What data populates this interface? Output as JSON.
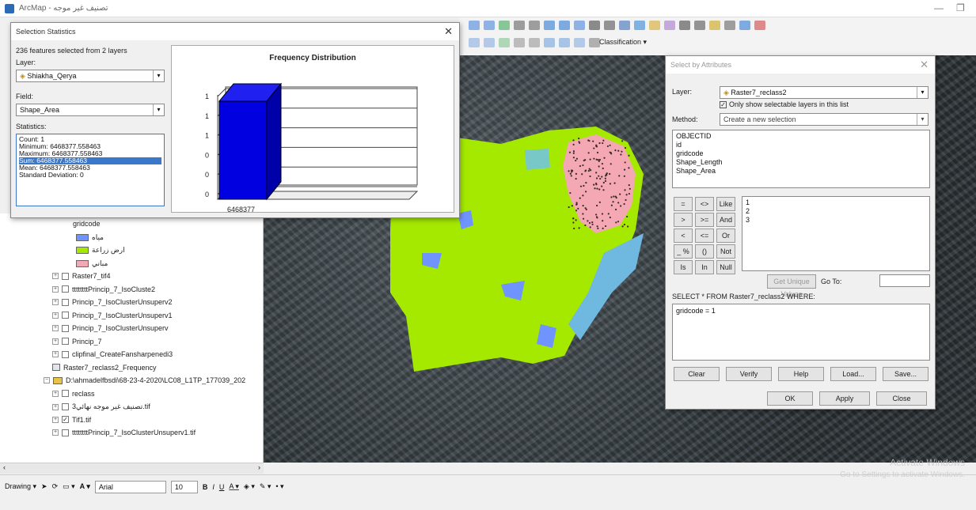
{
  "window": {
    "title": "ArcMap - تصنيف غير موجه"
  },
  "toolbar": {
    "classification_label": "Classification ▾"
  },
  "selection_stats": {
    "title": "Selection Statistics",
    "summary": "236 features selected from 2 layers",
    "layer_label": "Layer:",
    "layer_value": "Shiakha_Qerya",
    "field_label": "Field:",
    "field_value": "Shape_Area",
    "stats_label": "Statistics:",
    "stats_lines": [
      "Count: 1",
      "Minimum: 6468377.558463",
      "Maximum: 6468377.558463",
      "Sum: 6468377.558463",
      "Mean: 6468377.558463",
      "Standard Deviation: 0"
    ],
    "chart_title": "Frequency Distribution",
    "y_ticks": [
      "1",
      "1",
      "1",
      "0",
      "0",
      "0"
    ],
    "x_label": "6468377"
  },
  "chart_data": {
    "type": "bar",
    "title": "Frequency Distribution",
    "categories": [
      "6468377"
    ],
    "values": [
      1
    ],
    "ylim": [
      0,
      1
    ],
    "y_ticks": [
      "1",
      "1",
      "1",
      "0",
      "0",
      "0"
    ],
    "grid": true,
    "color": "#0000e0"
  },
  "toc": {
    "items": [
      {
        "label": "gridcode",
        "type": "heading"
      },
      {
        "label": "مياه",
        "type": "swatch",
        "color": "#6f93ff"
      },
      {
        "label": "ارض زراعة",
        "type": "swatch",
        "color": "#a5e900"
      },
      {
        "label": "مباني",
        "type": "swatch",
        "color": "#f4a8b4"
      },
      {
        "label": "Raster7_tif4",
        "type": "layer",
        "checked": false
      },
      {
        "label": "ttttttttPrincip_7_IsoCluste2",
        "type": "layer",
        "checked": false
      },
      {
        "label": "Princip_7_IsoClusterUnsuperv2",
        "type": "layer",
        "checked": false
      },
      {
        "label": "Princip_7_IsoClusterUnsuperv1",
        "type": "layer",
        "checked": false
      },
      {
        "label": "Princip_7_IsoClusterUnsuperv",
        "type": "layer",
        "checked": false
      },
      {
        "label": "Princip_7",
        "type": "layer",
        "checked": false
      },
      {
        "label": "clipfinal_CreateFansharpenedi3",
        "type": "layer",
        "checked": false
      },
      {
        "label": "Raster7_reclass2_Frequency",
        "type": "table"
      },
      {
        "label": "D:\\ahmadelfbsdi\\68-23-4-2020\\LC08_L1TP_177039_202",
        "type": "folder"
      },
      {
        "label": "reclass",
        "type": "layer",
        "checked": false
      },
      {
        "label": "تصنيف غير موجه نهائي3.tif",
        "type": "layer",
        "checked": false
      },
      {
        "label": "Tif1.tif",
        "type": "layer",
        "checked": true
      },
      {
        "label": "ttttttttPrincip_7_IsoClusterUnsuperv1.tif",
        "type": "layer",
        "checked": false
      }
    ]
  },
  "drawing_bar": {
    "drawing_label": "Drawing ▾",
    "font_name": "Arial",
    "font_size": "10"
  },
  "select_by_attr": {
    "title": "Select by Attributes",
    "layer_label": "Layer:",
    "layer_value": "Raster7_reclass2",
    "only_selectable": "Only show selectable layers in this list",
    "method_label": "Method:",
    "method_value": "Create a new selection",
    "fields": [
      "OBJECTID",
      "id",
      "gridcode",
      "Shape_Length",
      "Shape_Area"
    ],
    "operators": [
      "=",
      "<>",
      "Like",
      ">",
      ">=",
      "And",
      "<",
      "<=",
      "Or",
      "_ %",
      "()",
      "Not",
      "Is",
      "In",
      "Null"
    ],
    "values": [
      "1",
      "2",
      "3"
    ],
    "get_unique": "Get Unique Values",
    "go_to": "Go To:",
    "sql_prefix": "SELECT * FROM Raster7_reclass2 WHERE:",
    "expression": "gridcode = 1",
    "buttons": [
      "Clear",
      "Verify",
      "Help",
      "Load...",
      "Save..."
    ],
    "ok": "OK",
    "apply": "Apply",
    "close": "Close"
  },
  "watermark": {
    "line1": "Activate Windows",
    "line2": "Go to Settings to activate Windows."
  }
}
